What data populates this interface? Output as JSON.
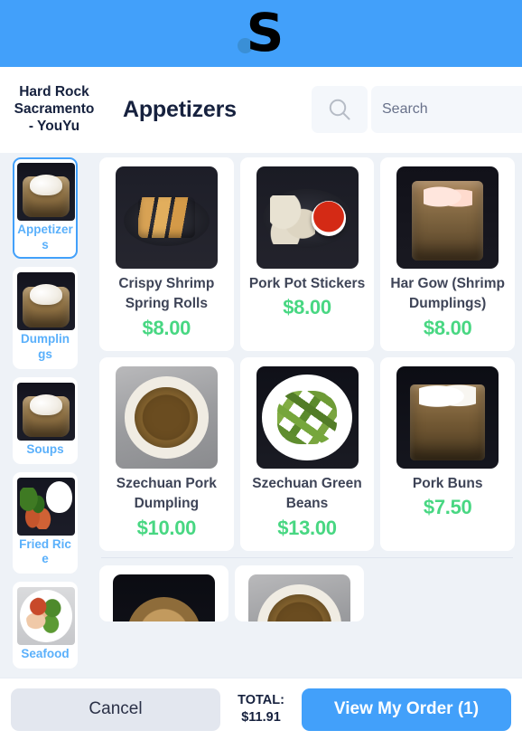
{
  "brand": {
    "logo_letter": "S",
    "logo_icon": "s-logo-with-dot",
    "banner_color": "#42a0fa"
  },
  "header": {
    "restaurant_name": "Hard Rock Sacramento - YouYu",
    "page_title": "Appetizers",
    "search": {
      "icon": "search-icon",
      "placeholder": "Search",
      "value": ""
    }
  },
  "sidebar": {
    "active_index": 0,
    "categories": [
      {
        "label": "Appetizers",
        "thumb": "ph-steamer",
        "active": true
      },
      {
        "label": "Dumplings",
        "thumb": "ph-steamer",
        "active": false
      },
      {
        "label": "Soups",
        "thumb": "ph-steamer",
        "active": false
      },
      {
        "label": "Fried Rice",
        "thumb": "ph-friedrice",
        "active": false
      },
      {
        "label": "Seafood",
        "thumb": "ph-seafood",
        "active": false
      }
    ]
  },
  "menu": {
    "rows": [
      [
        {
          "name": "Crispy Shrimp Spring Rolls",
          "price": "$8.00",
          "thumb": "ph-springrolls"
        },
        {
          "name": "Pork Pot Stickers",
          "price": "$8.00",
          "thumb": "ph-potsticker"
        },
        {
          "name": "Har Gow (Shrimp Dumplings)",
          "price": "$8.00",
          "thumb": "ph-hargow"
        }
      ],
      [
        {
          "name": "Szechuan Pork Dumpling",
          "price": "$10.00",
          "thumb": "ph-szechuan-dump"
        },
        {
          "name": "Szechuan Green Beans",
          "price": "$13.00",
          "thumb": "ph-greenbeans"
        },
        {
          "name": "Pork Buns",
          "price": "$7.50",
          "thumb": "ph-porkbuns"
        }
      ]
    ],
    "partial_row": [
      {
        "thumb": "ph-soupbowl"
      },
      {
        "thumb": "ph-szechuan-dump"
      }
    ]
  },
  "footer": {
    "cancel_label": "Cancel",
    "total_label": "TOTAL:",
    "total_amount": "$11.91",
    "order_label": "View My Order (1)"
  },
  "colors": {
    "accent_blue": "#42a0fa",
    "price_green": "#48d782",
    "text_dark": "#16213e",
    "page_bg": "#eef2f7"
  }
}
